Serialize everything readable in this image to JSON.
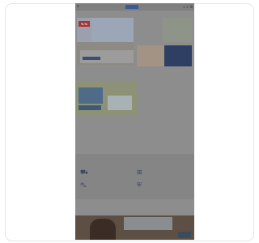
{
  "page": {
    "top_bar": {
      "menu_icon": "menu-icon",
      "logo_icon": "brand-logo",
      "icons": [
        "search-icon",
        "user-icon",
        "cart-icon"
      ],
      "icon_glyphs": "⌕ ☺ ◍"
    },
    "hero": {
      "badge": "% %",
      "promo_title": "",
      "promo_button": "",
      "promo_link": ""
    },
    "side": {
      "label_a": "",
      "blue_box_label": ""
    },
    "section_labels": {
      "s1": "",
      "s2": "",
      "s3": ""
    },
    "benefits": {
      "title": "",
      "items": [
        {
          "icon": "truck-icon",
          "text": ""
        },
        {
          "icon": "gift-icon",
          "text": ""
        },
        {
          "icon": "cart-icon",
          "text": ""
        },
        {
          "icon": "shield-icon",
          "text": ""
        }
      ]
    },
    "bottom": {
      "label": ""
    }
  }
}
